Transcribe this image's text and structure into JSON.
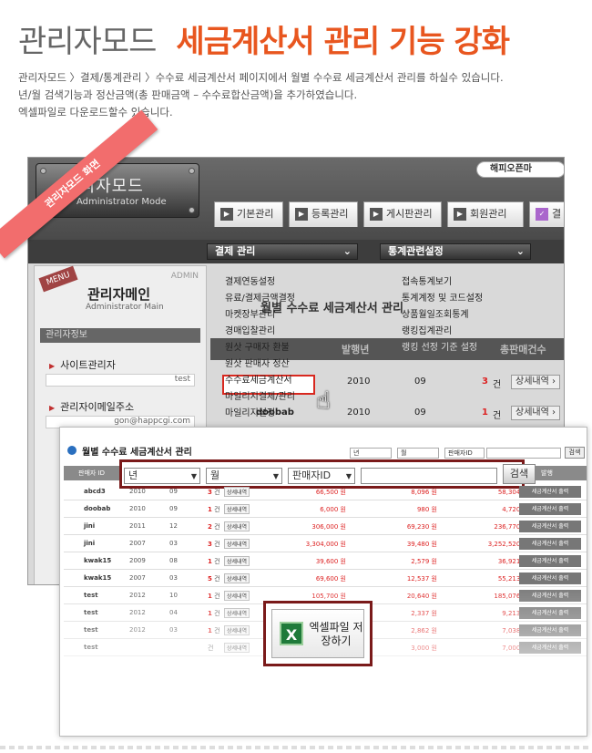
{
  "header": {
    "title_gray": "관리자모드",
    "title_orange": "세금계산서 관리 기능 강화",
    "desc_lines": [
      "관리자모드 〉결제/통계관리 〉수수료 세금계산서 페이지에서 월별 수수료 세금계산서 관리를 하실수 있습니다.",
      "년/월 검색기능과 정산금액(총 판매금액 – 수수료합산금액)을 추가하였습니다.",
      "엑셀파일로 다운로드할수 있습니다."
    ]
  },
  "ribbon": "관리자모드 화면",
  "admin": {
    "logo_main": "관리자모드",
    "logo_sub": "Administrator Mode",
    "site_link": "해피오픈마",
    "tabs": [
      "기본관리",
      "등록관리",
      "게시판관리",
      "회원관리",
      "결"
    ],
    "dd1": "결제 관리",
    "dd2": "통계관련설정",
    "sidebar": {
      "menu_tag": "MENU",
      "admin_tag": "ADMIN",
      "title": "관리자메인",
      "sub": "Administrator Main",
      "info": "관리자정보",
      "site_admin_label": "사이트관리자",
      "site_admin_value": "test",
      "email_label": "관리자이메일주소",
      "email_value": "gon@happcgi.com"
    },
    "menu1": [
      "결제연동설정",
      "유료/결제금액결정",
      "마켓장부관리",
      "경매입찰관리",
      "원삿 구매자 환불",
      "원삿 판매자 정산",
      "수수료세금계산서",
      "마일리지결제/관리",
      "마일리지설정"
    ],
    "menu2": [
      "접속통계보기",
      "통계계정 및 코드설정",
      "상품월일조회통계",
      "랭킹집계관리",
      "랭킹 선정 기준 설정"
    ],
    "bg_title": "월별 수수료 세금계산서 관리",
    "bg_headers": [
      "발행년",
      "총판매건수"
    ],
    "bg_rows": [
      {
        "id": "",
        "year": "2010",
        "month": "09",
        "count": "3",
        "unit": "건",
        "btn": "상세내역"
      },
      {
        "id": "doobab",
        "year": "2010",
        "month": "09",
        "count": "1",
        "unit": "건",
        "btn": "상세내역"
      }
    ]
  },
  "front": {
    "title": "월별 수수료 세금계산서 관리",
    "mini_selects": [
      "년",
      "월",
      "판매자ID"
    ],
    "mini_btn": "검색",
    "th": [
      "판매자 ID",
      "발행"
    ],
    "search": {
      "year": "년",
      "month": "월",
      "seller": "판매자ID",
      "button": "검색"
    },
    "rows": [
      {
        "id": "abcd3",
        "year": "2010",
        "month": "09",
        "count": "3",
        "sales": "66,500 원",
        "fee": "8,096 원",
        "net": "58,304 원"
      },
      {
        "id": "doobab",
        "year": "2010",
        "month": "09",
        "count": "1",
        "sales": "6,000 원",
        "fee": "980 원",
        "net": "4,720 원"
      },
      {
        "id": "jini",
        "year": "2011",
        "month": "12",
        "count": "2",
        "sales": "306,000 원",
        "fee": "69,230 원",
        "net": "236,770 원"
      },
      {
        "id": "jini",
        "year": "2007",
        "month": "03",
        "count": "3",
        "sales": "3,304,000 원",
        "fee": "39,480 원",
        "net": "3,252,520 원"
      },
      {
        "id": "kwak15",
        "year": "2009",
        "month": "08",
        "count": "1",
        "sales": "39,600 원",
        "fee": "2,579 원",
        "net": "36,921 원"
      },
      {
        "id": "kwak15",
        "year": "2007",
        "month": "03",
        "count": "5",
        "sales": "69,600 원",
        "fee": "12,537 원",
        "net": "55,213 원"
      },
      {
        "id": "test",
        "year": "2012",
        "month": "10",
        "count": "1",
        "sales": "105,700 원",
        "fee": "20,640 원",
        "net": "185,076 원"
      },
      {
        "id": "test",
        "year": "2012",
        "month": "04",
        "count": "1",
        "sales": "",
        "fee": "2,337 원",
        "net": "9,213 원"
      },
      {
        "id": "test",
        "year": "2012",
        "month": "03",
        "count": "1",
        "sales": "",
        "fee": "2,862 원",
        "net": "7,038 원"
      },
      {
        "id": "test",
        "year": "",
        "month": "",
        "count": "",
        "sales": "",
        "fee": "3,000 원",
        "net": "7,000 원"
      }
    ],
    "detail_label": "상세내역",
    "output_label": "세금계산서 출력",
    "count_unit": "건",
    "excel_label": "엑셀파일 저장하기"
  }
}
